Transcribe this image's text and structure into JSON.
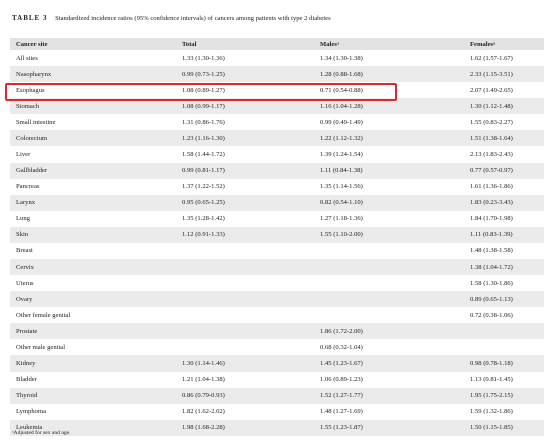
{
  "caption": {
    "label": "TABLE 3",
    "text": "Standardized incidence ratios (95% confidence intervals) of cancers among patients with type 2 diabetes"
  },
  "columns": [
    "Cancer site",
    "Total",
    "Malesᵃ",
    "Femalesᵃ"
  ],
  "rows": [
    {
      "site": "All sites",
      "total": "1.33 (1.30-1.36)",
      "males": "1.34 (1.30-1.38)",
      "females": "1.62 (1.57-1.67)"
    },
    {
      "site": "Nasopharynx",
      "total": "0.99 (0.73-1.25)",
      "males": "1.28 (0.88-1.68)",
      "females": "2.33 (1.15-3.51)"
    },
    {
      "site": "Esophagus",
      "total": "1.08 (0.89-1.27)",
      "males": "0.71 (0.54-0.88)",
      "females": "2.07 (1.49-2.65)"
    },
    {
      "site": "Stomach",
      "total": "1.08 (0.99-1.17)",
      "males": "1.16 (1.04-1.28)",
      "females": "1.30 (1.12-1.48)"
    },
    {
      "site": "Small intestine",
      "total": "1.31 (0.86-1.76)",
      "males": "0.99 (0.49-1.49)",
      "females": "1.55 (0.83-2.27)"
    },
    {
      "site": "Colorectum",
      "total": "1.23 (1.16-1.30)",
      "males": "1.22 (1.12-1.32)",
      "females": "1.51 (1.38-1.64)"
    },
    {
      "site": "Liver",
      "total": "1.58 (1.44-1.72)",
      "males": "1.39 (1.24-1.54)",
      "females": "2.13 (1.83-2.43)"
    },
    {
      "site": "Gallbladder",
      "total": "0.99 (0.81-1.17)",
      "males": "1.11 (0.84-1.38)",
      "females": "0.77 (0.57-0.97)"
    },
    {
      "site": "Pancreas",
      "total": "1.37 (1.22-1.52)",
      "males": "1.35 (1.14-1.56)",
      "females": "1.61 (1.36-1.86)"
    },
    {
      "site": "Larynx",
      "total": "0.95 (0.65-1.25)",
      "males": "0.82 (0.54-1.10)",
      "females": "1.83 (0.23-3.43)"
    },
    {
      "site": "Lung",
      "total": "1.35 (1.28-1.42)",
      "males": "1.27 (1.18-1.36)",
      "females": "1.84 (1.70-1.98)"
    },
    {
      "site": "Skin",
      "total": "1.12 (0.91-1.33)",
      "males": "1.55 (1.10-2.00)",
      "females": "1.11 (0.83-1.39)"
    },
    {
      "site": "Breast",
      "total": "",
      "males": "",
      "females": "1.48 (1.38-1.58)"
    },
    {
      "site": "Cervix",
      "total": "",
      "males": "",
      "females": "1.38 (1.04-1.72)"
    },
    {
      "site": "Uterus",
      "total": "",
      "males": "",
      "females": "1.58 (1.30-1.86)"
    },
    {
      "site": "Ovary",
      "total": "",
      "males": "",
      "females": "0.89 (0.65-1.13)"
    },
    {
      "site": "Other female genital",
      "total": "",
      "males": "",
      "females": "0.72 (0.38-1.06)"
    },
    {
      "site": "Prostate",
      "total": "",
      "males": "1.86 (1.72-2.00)",
      "females": ""
    },
    {
      "site": "Other male genital",
      "total": "",
      "males": "0.68 (0.32-1.04)",
      "females": ""
    },
    {
      "site": "Kidney",
      "total": "1.30 (1.14-1.46)",
      "males": "1.45 (1.23-1.67)",
      "females": "0.98 (0.78-1.18)"
    },
    {
      "site": "Bladder",
      "total": "1.21 (1.04-1.38)",
      "males": "1.06 (0.89-1.23)",
      "females": "1.13 (0.81-1.45)"
    },
    {
      "site": "Thyroid",
      "total": "0.86 (0.79-0.93)",
      "males": "1.52 (1.27-1.77)",
      "females": "1.95 (1.75-2.15)"
    },
    {
      "site": "Lymphoma",
      "total": "1.82 (1.62-2.02)",
      "males": "1.48 (1.27-1.69)",
      "females": "1.59 (1.32-1.86)"
    },
    {
      "site": "Leukemia",
      "total": "1.98 (1.68-2.28)",
      "males": "1.55 (1.23-1.87)",
      "females": "1.50 (1.15-1.85)"
    }
  ],
  "footnote": "ᵃAdjusted for sex and age.",
  "colors": {
    "highlight_border": "#e3262c",
    "header_bg": "#e3e3e3",
    "stripe_bg": "#ebebeb"
  }
}
